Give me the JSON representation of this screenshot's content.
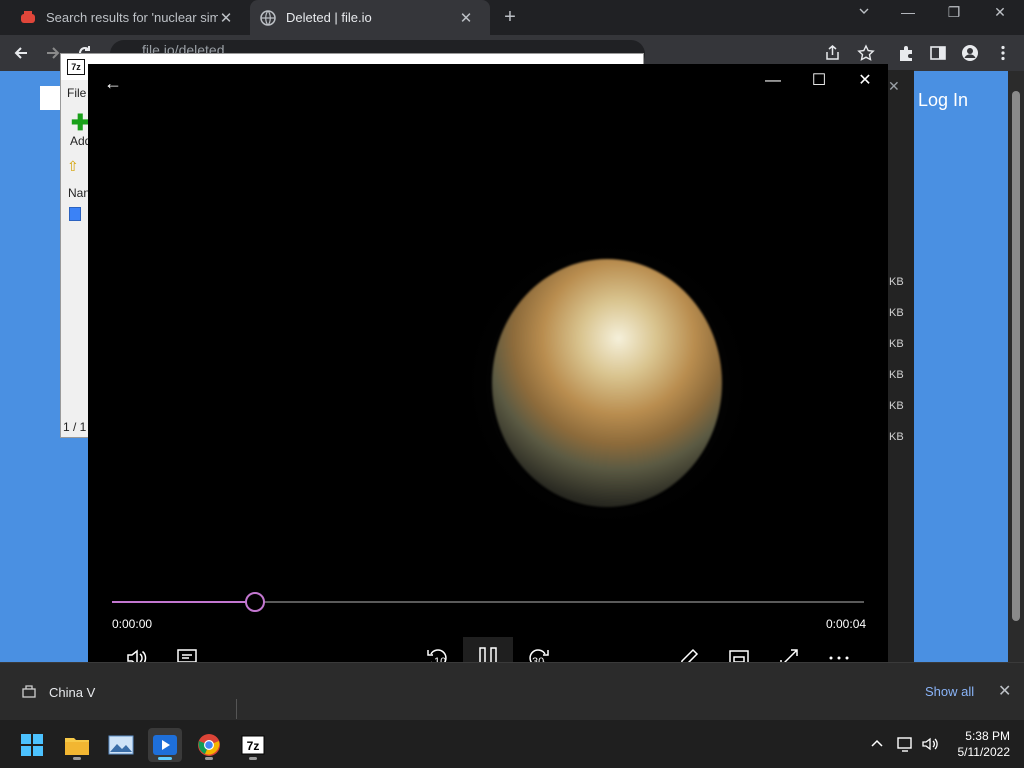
{
  "browser": {
    "tabs": [
      {
        "title": "Search results for 'nuclear simula",
        "close": "✕",
        "icon": "game-controller-icon"
      },
      {
        "title": "Deleted | file.io",
        "close": "✕",
        "icon": "globe-icon"
      }
    ],
    "new_tab": "+",
    "url": "file.io/deleted",
    "window_controls": {
      "minimize": "—",
      "restore": "❐",
      "close": "✕"
    }
  },
  "page": {
    "login_label": "Log In",
    "list_sizes": [
      "KB",
      "KB",
      "KB",
      "KB",
      "KB",
      "KB"
    ]
  },
  "sevenzip": {
    "logo": "7z",
    "menu": "File",
    "add_label": "Add",
    "column_name": "Nan",
    "status": "1 / 1"
  },
  "player": {
    "back": "←",
    "controls": {
      "minimize": "—",
      "maximize": "☐",
      "close": "✕"
    },
    "position_fraction": 0.19,
    "elapsed": "0:00:00",
    "remaining": "0:00:04",
    "skip_back_label": "10",
    "skip_forward_label": "30",
    "accent": "#c377d0"
  },
  "notification": {
    "text": "China V",
    "show_all": "Show all",
    "close": "✕"
  },
  "taskbar": {
    "apps": [
      "start-icon",
      "file-explorer-icon",
      "photos-icon",
      "media-player-icon",
      "chrome-icon",
      "7zip-icon"
    ],
    "time": "5:38 PM",
    "date": "5/11/2022"
  }
}
